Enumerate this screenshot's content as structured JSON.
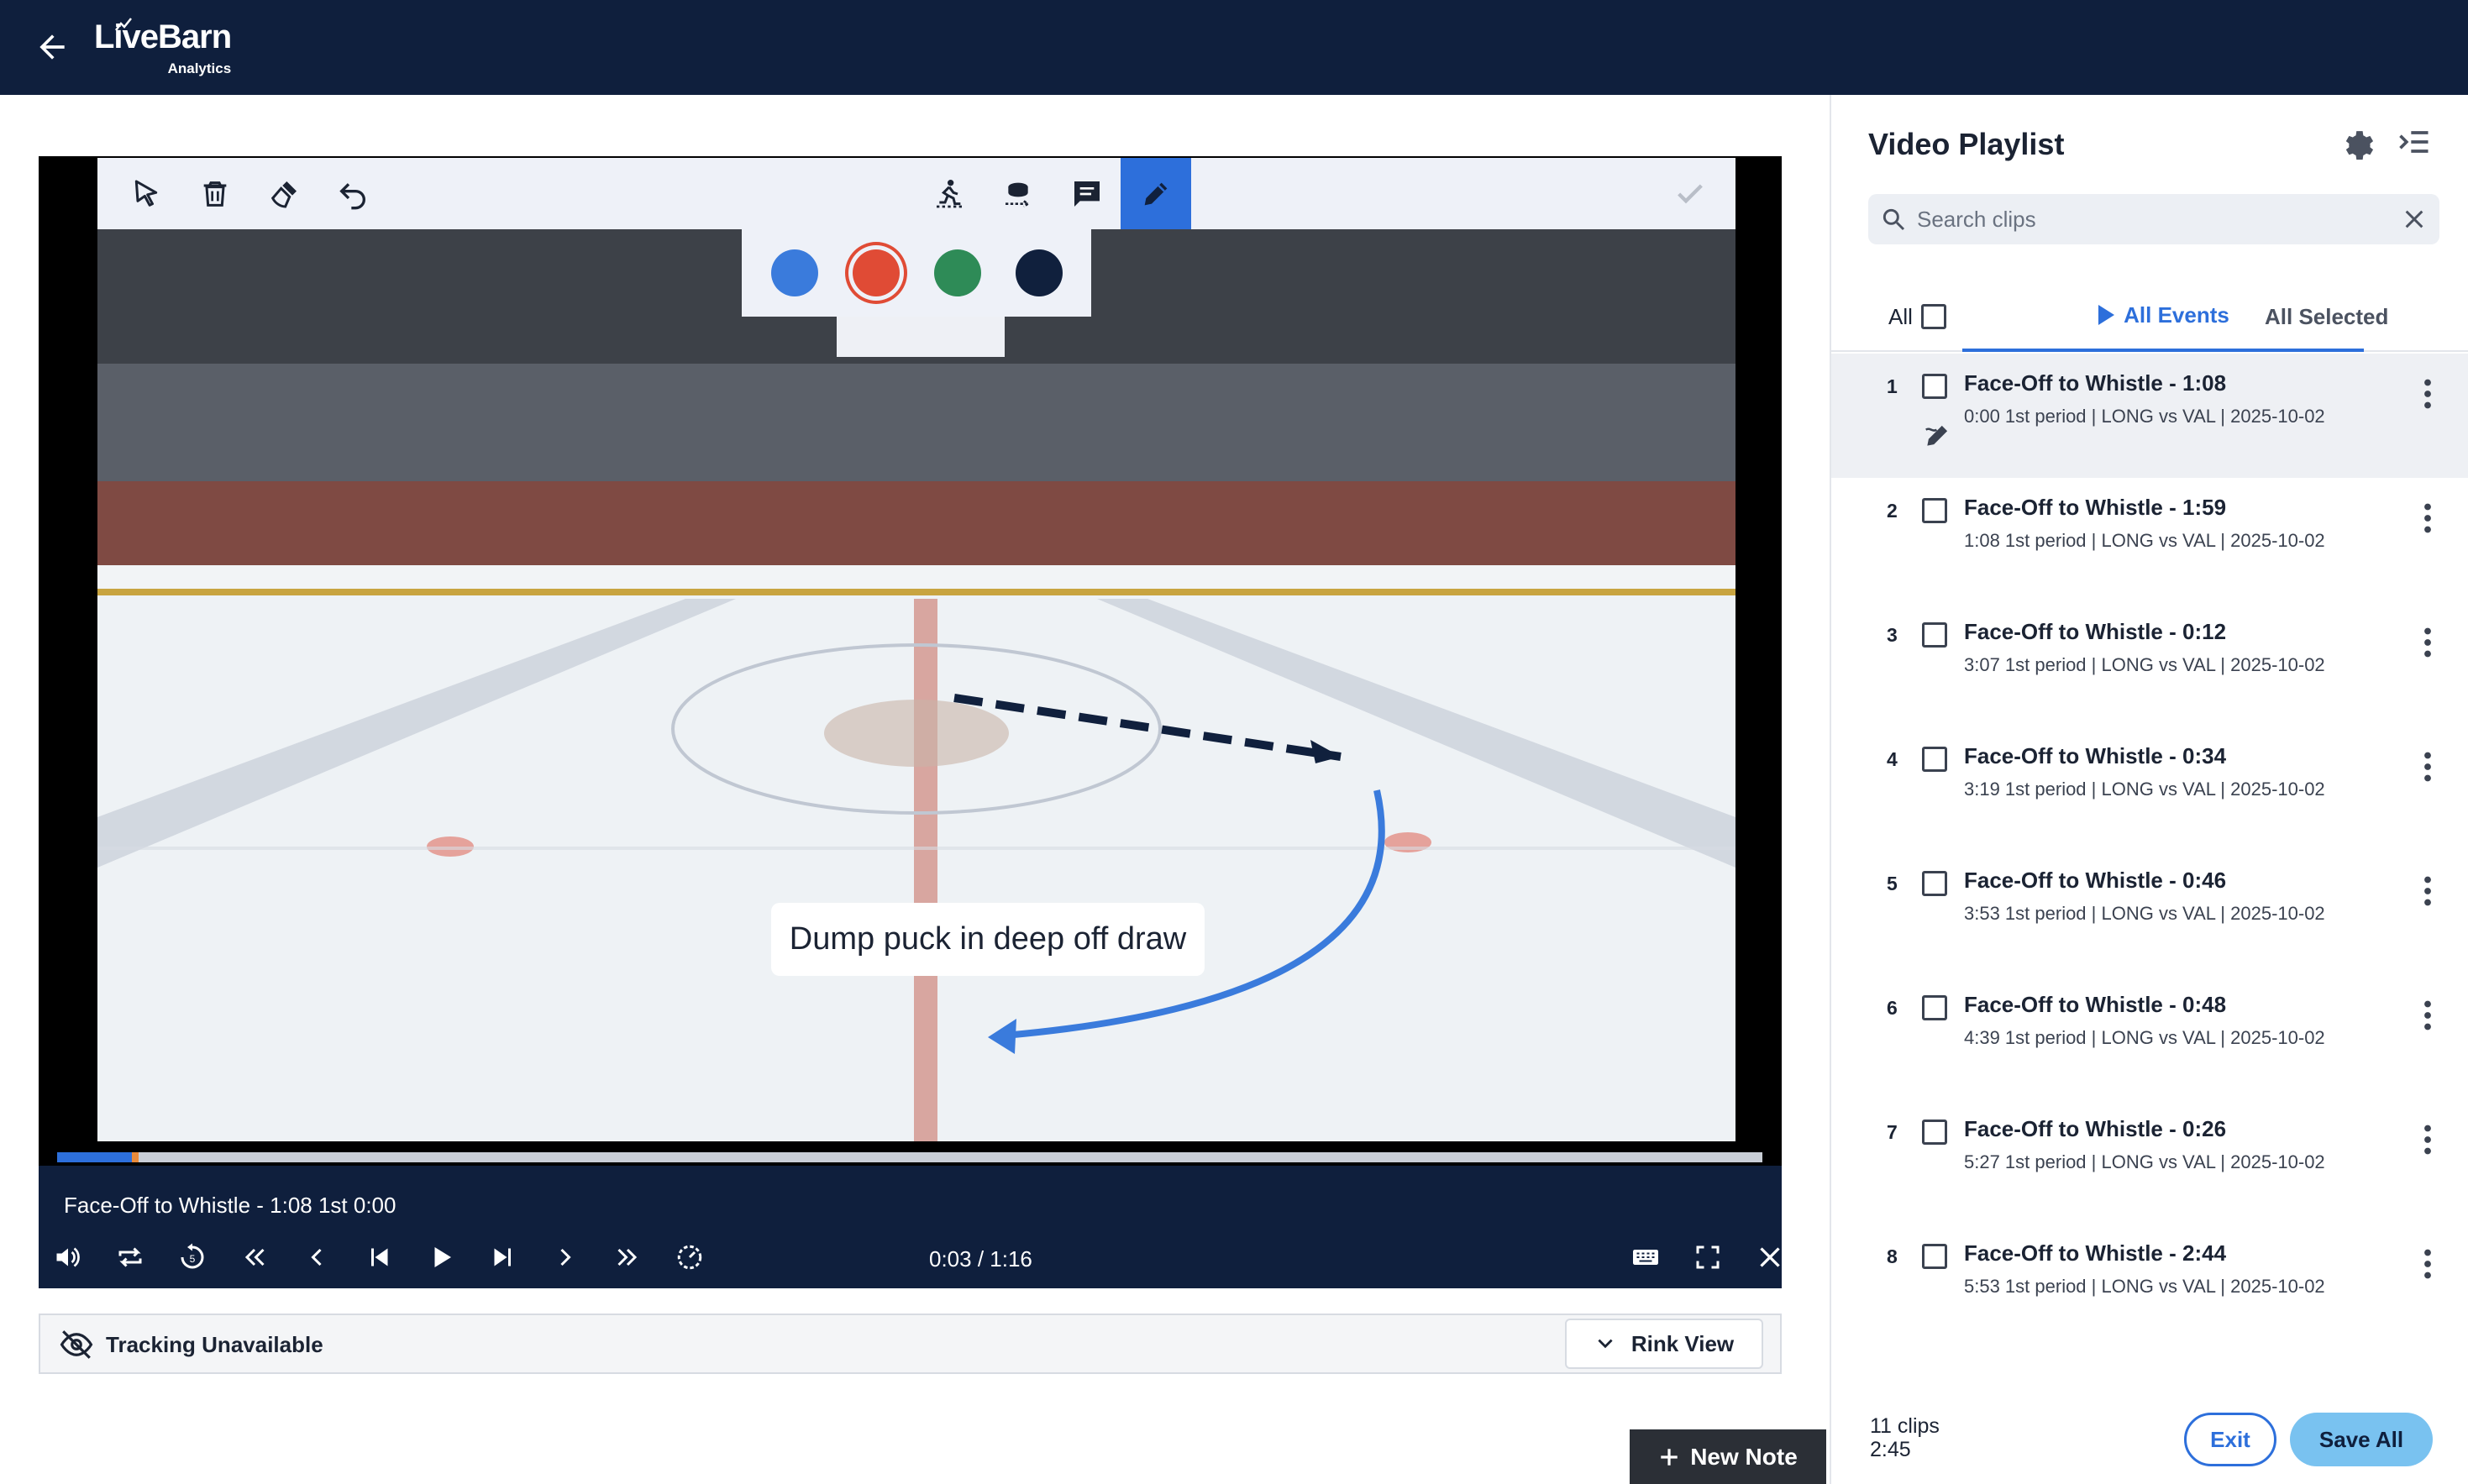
{
  "header": {
    "logo_main": "LiveBarn",
    "logo_sub": "Analytics",
    "back_icon": "arrow-left-icon"
  },
  "toolbar": {
    "tools": [
      "select-pointer-icon",
      "trash-icon",
      "eraser-brush-icon",
      "undo-icon",
      "skater-icon",
      "puck-path-icon",
      "comment-icon",
      "pencil-icon"
    ],
    "active_tool": "pencil-icon",
    "confirm_icon": "checkmark-icon"
  },
  "palette": {
    "colors": [
      "#3a7bdc",
      "#e04b35",
      "#2e8b57",
      "#10203d"
    ],
    "selected": "#e04b35"
  },
  "annotation": {
    "note_text": "Dump puck in deep off draw"
  },
  "player": {
    "caption": "Face-Off to Whistle - 1:08 1st 0:00",
    "time": "0:03 / 1:16",
    "progress": 0.044
  },
  "tracking": {
    "label": "Tracking Unavailable",
    "rink_view_label": "Rink View"
  },
  "new_note_label": "New Note",
  "playlist": {
    "title": "Video Playlist",
    "search_placeholder": "Search clips",
    "tab_all": "All",
    "tab_events": "All Events",
    "tab_selected": "All Selected",
    "clips": [
      {
        "num": "1",
        "title": "Face-Off to Whistle - 1:08",
        "meta": "0:00 1st period | LONG vs VAL | 2025-10-02"
      },
      {
        "num": "2",
        "title": "Face-Off to Whistle - 1:59",
        "meta": "1:08 1st period | LONG vs VAL | 2025-10-02"
      },
      {
        "num": "3",
        "title": "Face-Off to Whistle - 0:12",
        "meta": "3:07 1st period | LONG vs VAL | 2025-10-02"
      },
      {
        "num": "4",
        "title": "Face-Off to Whistle - 0:34",
        "meta": "3:19 1st period | LONG vs VAL | 2025-10-02"
      },
      {
        "num": "5",
        "title": "Face-Off to Whistle - 0:46",
        "meta": "3:53 1st period | LONG vs VAL | 2025-10-02"
      },
      {
        "num": "6",
        "title": "Face-Off to Whistle - 0:48",
        "meta": "4:39 1st period | LONG vs VAL | 2025-10-02"
      },
      {
        "num": "7",
        "title": "Face-Off to Whistle - 0:26",
        "meta": "5:27 1st period | LONG vs VAL | 2025-10-02"
      },
      {
        "num": "8",
        "title": "Face-Off to Whistle - 2:44",
        "meta": "5:53 1st period | LONG vs VAL | 2025-10-02"
      }
    ],
    "clip_count": "11 clips",
    "total_time": "2:45",
    "exit_label": "Exit",
    "save_label": "Save All"
  }
}
